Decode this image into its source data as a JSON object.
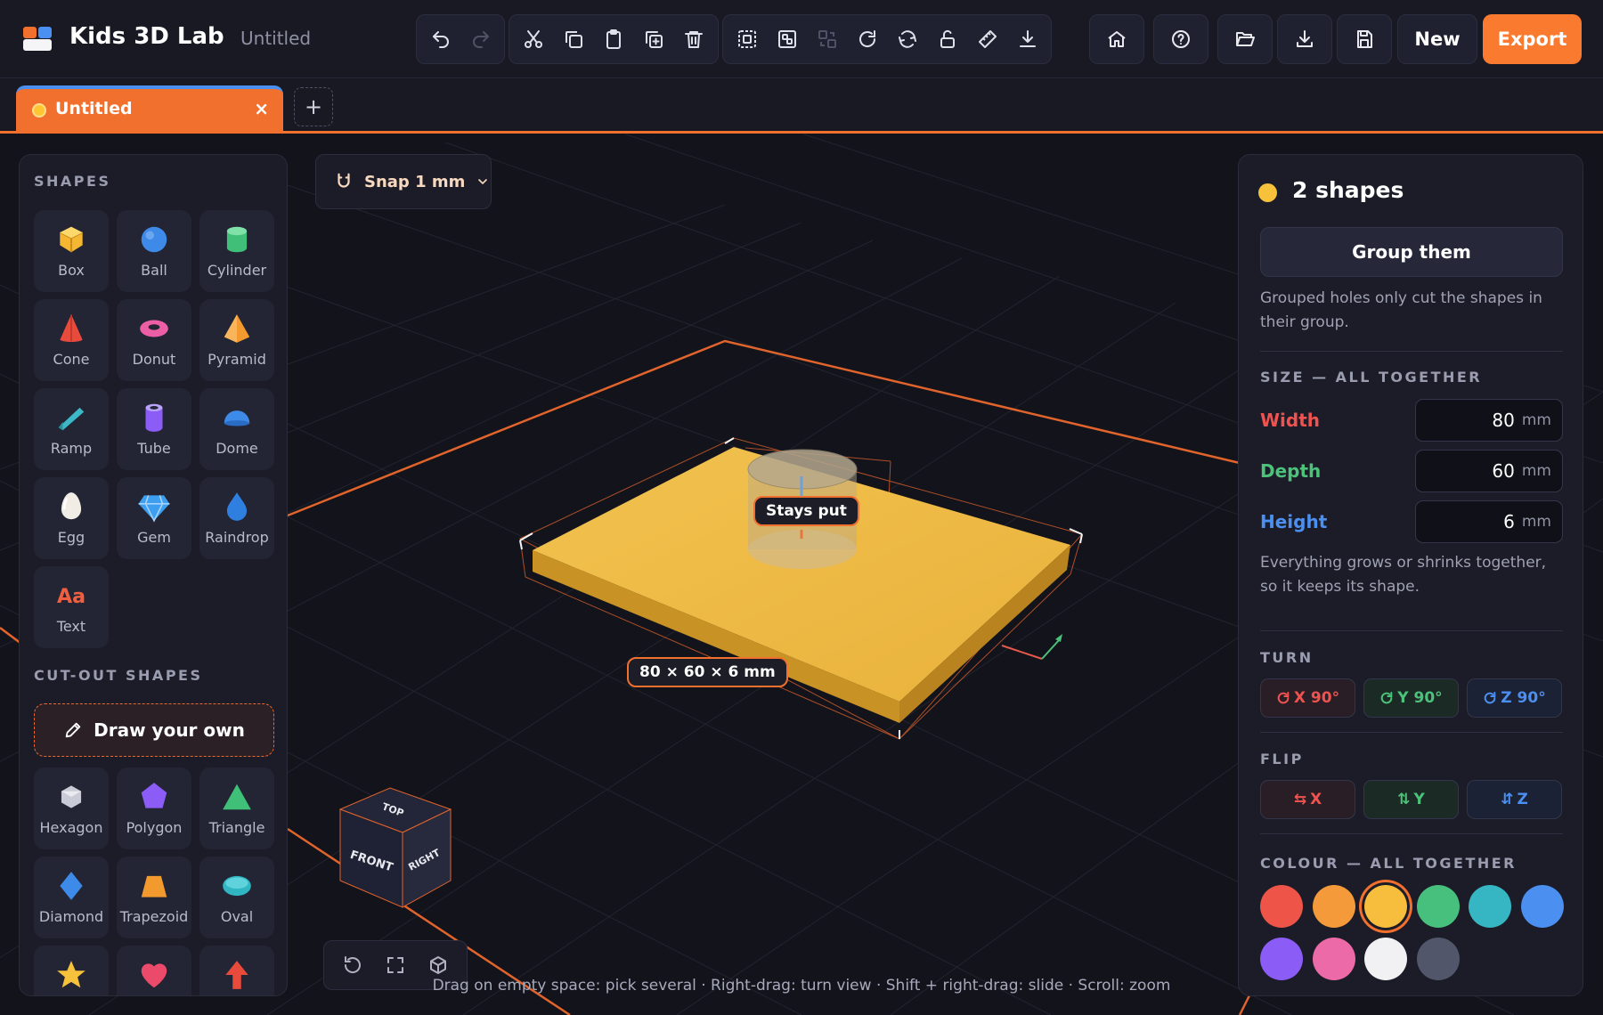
{
  "app": {
    "title": "Kids 3D Lab",
    "document_title": "Untitled"
  },
  "toolbar": {
    "group1": [
      "undo-icon",
      "redo-icon"
    ],
    "group2": [
      "cut-icon",
      "copy-icon",
      "paste-icon",
      "duplicate-icon",
      "delete-icon"
    ],
    "group3": [
      "group-icon",
      "ungroup-icon",
      "align-icon",
      "rotate-icon",
      "mirror-icon",
      "unlock-icon",
      "ruler-icon",
      "drop-to-floor-icon"
    ],
    "right": [
      "home-icon",
      "help-icon",
      "open-folder-icon",
      "import-icon",
      "save-icon"
    ],
    "new_label": "New",
    "export_label": "Export"
  },
  "tabs": [
    {
      "label": "Untitled",
      "close": "×"
    }
  ],
  "tab_add": "+",
  "snap": {
    "label": "Snap 1 mm"
  },
  "left_panel": {
    "shapes_heading": "SHAPES",
    "shapes": [
      {
        "label": "Box",
        "icon": "box-icon",
        "color": "#f5b731"
      },
      {
        "label": "Ball",
        "icon": "ball-icon",
        "color": "#3d8ae8"
      },
      {
        "label": "Cylinder",
        "icon": "cylinder-icon",
        "color": "#3fbf77"
      },
      {
        "label": "Cone",
        "icon": "cone-icon",
        "color": "#e84a3c"
      },
      {
        "label": "Donut",
        "icon": "donut-icon",
        "color": "#ec5fa6"
      },
      {
        "label": "Pyramid",
        "icon": "pyramid-icon",
        "color": "#f29a2e"
      },
      {
        "label": "Ramp",
        "icon": "ramp-icon",
        "color": "#3cb8c7"
      },
      {
        "label": "Tube",
        "icon": "tube-icon",
        "color": "#8b5cf6"
      },
      {
        "label": "Dome",
        "icon": "dome-icon",
        "color": "#3d8ae8"
      },
      {
        "label": "Egg",
        "icon": "egg-icon",
        "color": "#f1ede4"
      },
      {
        "label": "Gem",
        "icon": "gem-icon",
        "color": "#3d9ff0"
      },
      {
        "label": "Raindrop",
        "icon": "raindrop-icon",
        "color": "#2f7fe0"
      },
      {
        "label": "Text",
        "icon": "text-icon",
        "glyph": "Aa",
        "color": "#f06040"
      }
    ],
    "cutout_heading": "CUT-OUT SHAPES",
    "draw_own_label": "Draw your own",
    "cutouts": [
      {
        "label": "Hexagon",
        "icon": "hexagon-icon",
        "color": "#c9ccd6"
      },
      {
        "label": "Polygon",
        "icon": "polygon-icon",
        "color": "#8b5cf6"
      },
      {
        "label": "Triangle",
        "icon": "triangle-icon",
        "color": "#3fbf77"
      },
      {
        "label": "Diamond",
        "icon": "diamond-icon",
        "color": "#3d8ae8"
      },
      {
        "label": "Trapezoid",
        "icon": "trapezoid-icon",
        "color": "#f29a2e"
      },
      {
        "label": "Oval",
        "icon": "oval-icon",
        "color": "#2fb6c2"
      },
      {
        "label": "",
        "icon": "star-icon",
        "color": "#f7c23b"
      },
      {
        "label": "",
        "icon": "heart-icon",
        "color": "#ec4a6a"
      },
      {
        "label": "",
        "icon": "arrow-up-icon",
        "color": "#e84a3c"
      }
    ]
  },
  "scene": {
    "dimension_label": "80 × 60 × 6 mm",
    "hole_label": "Stays put",
    "view_cube": {
      "top": "TOP",
      "front": "FRONT",
      "right": "RIGHT"
    },
    "hint": "Drag on empty space: pick several · Right-drag: turn view · Shift + right-drag: slide · Scroll: zoom",
    "view_controls": [
      "reset-view-icon",
      "fit-view-icon",
      "perspective-icon"
    ]
  },
  "right_panel": {
    "title": "2 shapes",
    "dot_color": "#f7c23b",
    "group_label": "Group them",
    "group_note": "Grouped holes only cut the shapes in their group.",
    "size_heading": "SIZE — ALL TOGETHER",
    "dims": [
      {
        "label": "Width",
        "value": "80",
        "unit": "mm",
        "color": "#ef5350"
      },
      {
        "label": "Depth",
        "value": "60",
        "unit": "mm",
        "color": "#4cc27a"
      },
      {
        "label": "Height",
        "value": "6",
        "unit": "mm",
        "color": "#4b8ff0"
      }
    ],
    "size_note": "Everything grows or shrinks together, so it keeps its shape.",
    "turn_heading": "TURN",
    "turn": [
      {
        "label": "X 90°",
        "color": "#ef5350",
        "bg": "#2a1e26",
        "icon": "rotate-x-icon"
      },
      {
        "label": "Y 90°",
        "color": "#4cc27a",
        "bg": "#1c2a25",
        "icon": "rotate-y-icon"
      },
      {
        "label": "Z 90°",
        "color": "#4b8ff0",
        "bg": "#1c2236",
        "icon": "rotate-z-icon"
      }
    ],
    "flip_heading": "FLIP",
    "flip": [
      {
        "label": "X",
        "color": "#ef5350",
        "bg": "#2a1e26",
        "glyph": "⇆",
        "icon": "flip-x-icon"
      },
      {
        "label": "Y",
        "color": "#4cc27a",
        "bg": "#1c2a25",
        "glyph": "⇅",
        "icon": "flip-y-icon"
      },
      {
        "label": "Z",
        "color": "#4b8ff0",
        "bg": "#1c2236",
        "glyph": "⇵",
        "icon": "flip-z-icon"
      }
    ],
    "colour_heading": "COLOUR — ALL TOGETHER",
    "swatches": [
      "#ee5548",
      "#f59a3a",
      "#f7bd3c",
      "#47c07e",
      "#35b6c2",
      "#4b8ff0",
      "#8b5cf6",
      "#ec6aa8",
      "#f1f1f3",
      "#52566a"
    ],
    "selected_swatch": "#f7bd3c"
  }
}
